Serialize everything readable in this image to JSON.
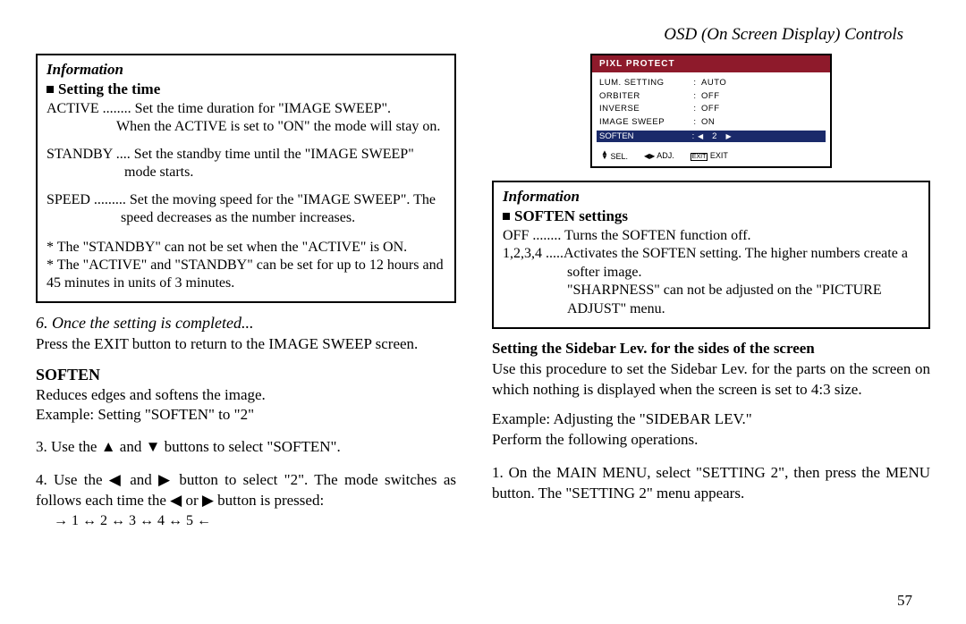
{
  "header": "OSD (On Screen Display) Controls",
  "left_info": {
    "title": "Information",
    "sub": "Setting the time",
    "active_line1": "ACTIVE ........ Set the time duration for \"IMAGE SWEEP\".",
    "active_line2": "When the ACTIVE is set to \"ON\" the mode will stay on.",
    "standby_line1": "STANDBY .... Set the standby time until the \"IMAGE SWEEP\" mode starts.",
    "speed_line1": "SPEED ......... Set the moving speed for the \"IMAGE SWEEP\". The speed decreases as the number increases.",
    "note1": "* The \"STANDBY\" can not be set when the \"ACTIVE\" is ON.",
    "note2": "* The \"ACTIVE\" and \"STANDBY\" can be set for up to 12 hours and 45 minutes in units of 3 minutes."
  },
  "step6_title": "6. Once the setting is completed...",
  "step6_body": "Press the EXIT button to return to the IMAGE SWEEP screen.",
  "soften": {
    "title": "SOFTEN",
    "desc1": "Reduces edges and softens the image.",
    "desc2": "Example: Setting \"SOFTEN\" to \"2\"",
    "step3": "3. Use the ▲ and ▼ buttons to select \"SOFTEN\".",
    "step4": "4. Use the ◀ and ▶ button to select \"2\".  The mode switches as follows each time the ◀ or ▶ button is pressed:",
    "seq": "→ 1 ↔ 2 ↔ 3  ↔ 4 ↔ 5 ←"
  },
  "osd": {
    "title": "PIXL PROTECT",
    "rows": [
      {
        "label": "LUM. SETTING",
        "value": "AUTO"
      },
      {
        "label": "ORBITER",
        "value": "OFF"
      },
      {
        "label": "INVERSE",
        "value": "OFF"
      },
      {
        "label": "IMAGE SWEEP",
        "value": "ON"
      }
    ],
    "hl": {
      "label": "SOFTEN",
      "value": "2"
    },
    "foot_sel": "SEL.",
    "foot_adj": "ADJ.",
    "foot_exit_box": "EXIT",
    "foot_exit": "EXIT"
  },
  "right_info": {
    "title": "Information",
    "sub": "SOFTEN settings",
    "off": "OFF ........ Turns the SOFTEN function off.",
    "nums": "1,2,3,4 .....Activates the SOFTEN setting.  The higher numbers create a softer image.",
    "sharp": "\"SHARPNESS\" can not be adjusted on the \"PICTURE ADJUST\" menu."
  },
  "sidebar": {
    "title": "Setting the Sidebar Lev. for the sides of the screen",
    "body": "Use this procedure to set the Sidebar Lev. for the parts on the screen on which nothing is displayed when the screen is set to 4:3 size.",
    "ex1": "Example: Adjusting the \"SIDEBAR LEV.\"",
    "ex2": "Perform the following operations.",
    "step1": "1. On the MAIN MENU, select \"SETTING 2\", then press the MENU button. The \"SETTING 2\" menu appears."
  },
  "page_number": "57"
}
